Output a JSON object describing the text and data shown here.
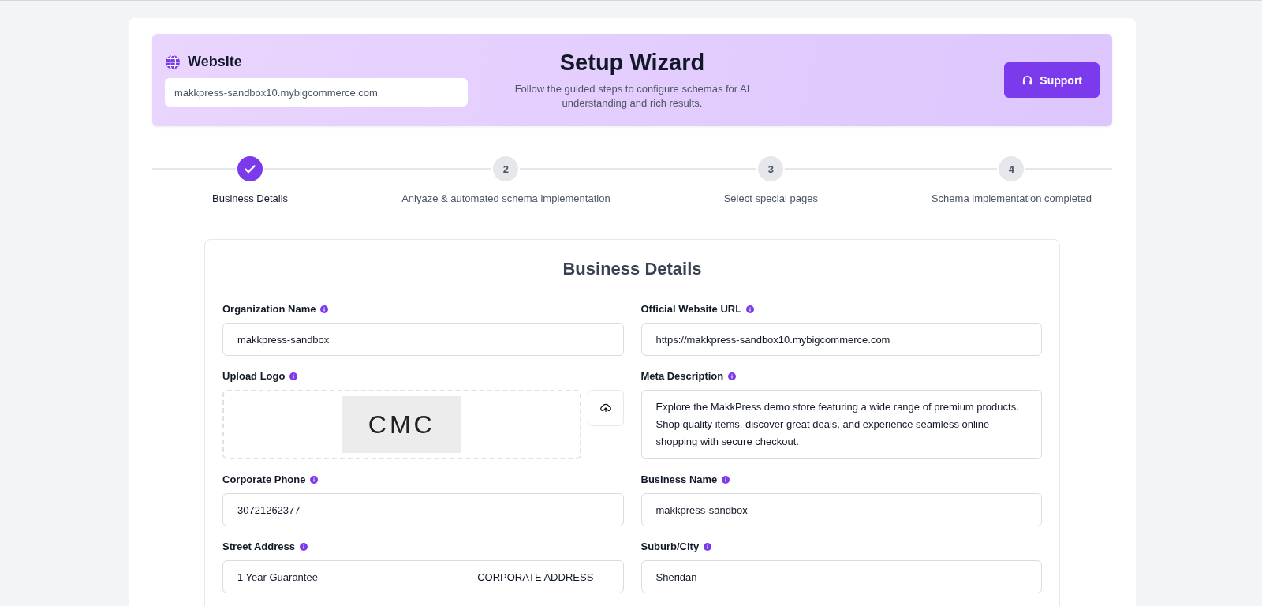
{
  "header": {
    "website_label": "Website",
    "website_value": "makkpress-sandbox10.mybigcommerce.com",
    "title": "Setup Wizard",
    "subtitle": "Follow the guided steps to configure schemas for AI understanding and rich results.",
    "support_button": "Support"
  },
  "steps": [
    {
      "label": "Business Details",
      "completed": true
    },
    {
      "number": "2",
      "label": "Anlyaze & automated schema implementation",
      "completed": false
    },
    {
      "number": "3",
      "label": "Select special pages",
      "completed": false
    },
    {
      "number": "4",
      "label": "Schema implementation completed",
      "completed": false
    }
  ],
  "form": {
    "title": "Business Details",
    "fields": [
      {
        "kind": "text",
        "label": "Organization Name",
        "value": "makkpress-sandbox"
      },
      {
        "kind": "text",
        "label": "Official Website URL",
        "value": "https://makkpress-sandbox10.mybigcommerce.com"
      },
      {
        "kind": "upload",
        "label": "Upload Logo",
        "logo_text": "CMC"
      },
      {
        "kind": "textarea",
        "label": "Meta Description",
        "value": "Explore the MakkPress demo store featuring a wide range of premium products. Shop quality items, discover great deals, and experience seamless online shopping with secure checkout."
      },
      {
        "kind": "text",
        "label": "Corporate Phone",
        "value": "30721262377"
      },
      {
        "kind": "text",
        "label": "Business Name",
        "value": "makkpress-sandbox"
      },
      {
        "kind": "text",
        "label": "Street Address",
        "value": "1 Year Guarantee                                                        CORPORATE ADDRESS"
      },
      {
        "kind": "text",
        "label": "Suburb/City",
        "value": "Sheridan"
      }
    ]
  }
}
